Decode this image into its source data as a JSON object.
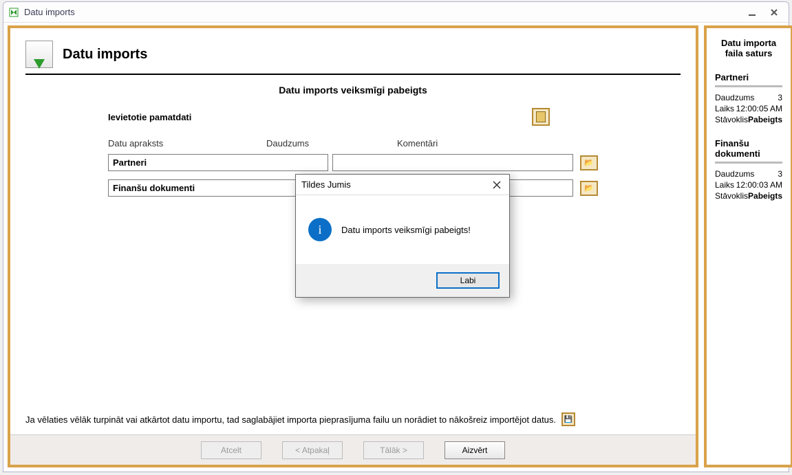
{
  "window": {
    "title": "Datu imports",
    "main": {
      "page_title": "Datu imports",
      "status": "Datu imports veiksmīgi pabeigts",
      "section_label": "Ievietotie pamatdati",
      "columns": {
        "c1": "Datu apraksts",
        "c2": "Daudzums",
        "c3": "Komentāri"
      },
      "rows": [
        {
          "label": "Partneri",
          "comment": ""
        },
        {
          "label": "Finanšu dokumenti",
          "comment": ""
        }
      ],
      "hint": "Ja vēlaties vēlāk turpināt vai atkārtot datu importu, tad saglabājiet importa pieprasījuma failu un norādiet to nākošreiz importējot datus."
    },
    "buttons": {
      "cancel": "Atcelt",
      "back": "< Atpakaļ",
      "next": "Tālāk >",
      "close": "Aizvērt"
    },
    "side": {
      "title": "Datu importa faila saturs",
      "sections": [
        {
          "name": "Partneri",
          "qty_label": "Daudzums",
          "qty": "3",
          "time_label": "Laiks",
          "time": "12:00:05 AM",
          "state_label": "Stāvoklis",
          "state": "Pabeigts"
        },
        {
          "name": "Finanšu dokumenti",
          "qty_label": "Daudzums",
          "qty": "3",
          "time_label": "Laiks",
          "time": "12:00:03 AM",
          "state_label": "Stāvoklis",
          "state": "Pabeigts"
        }
      ]
    }
  },
  "modal": {
    "title": "Tildes Jumis",
    "message": "Datu imports veiksmīgi pabeigts!",
    "ok": "Labi"
  }
}
